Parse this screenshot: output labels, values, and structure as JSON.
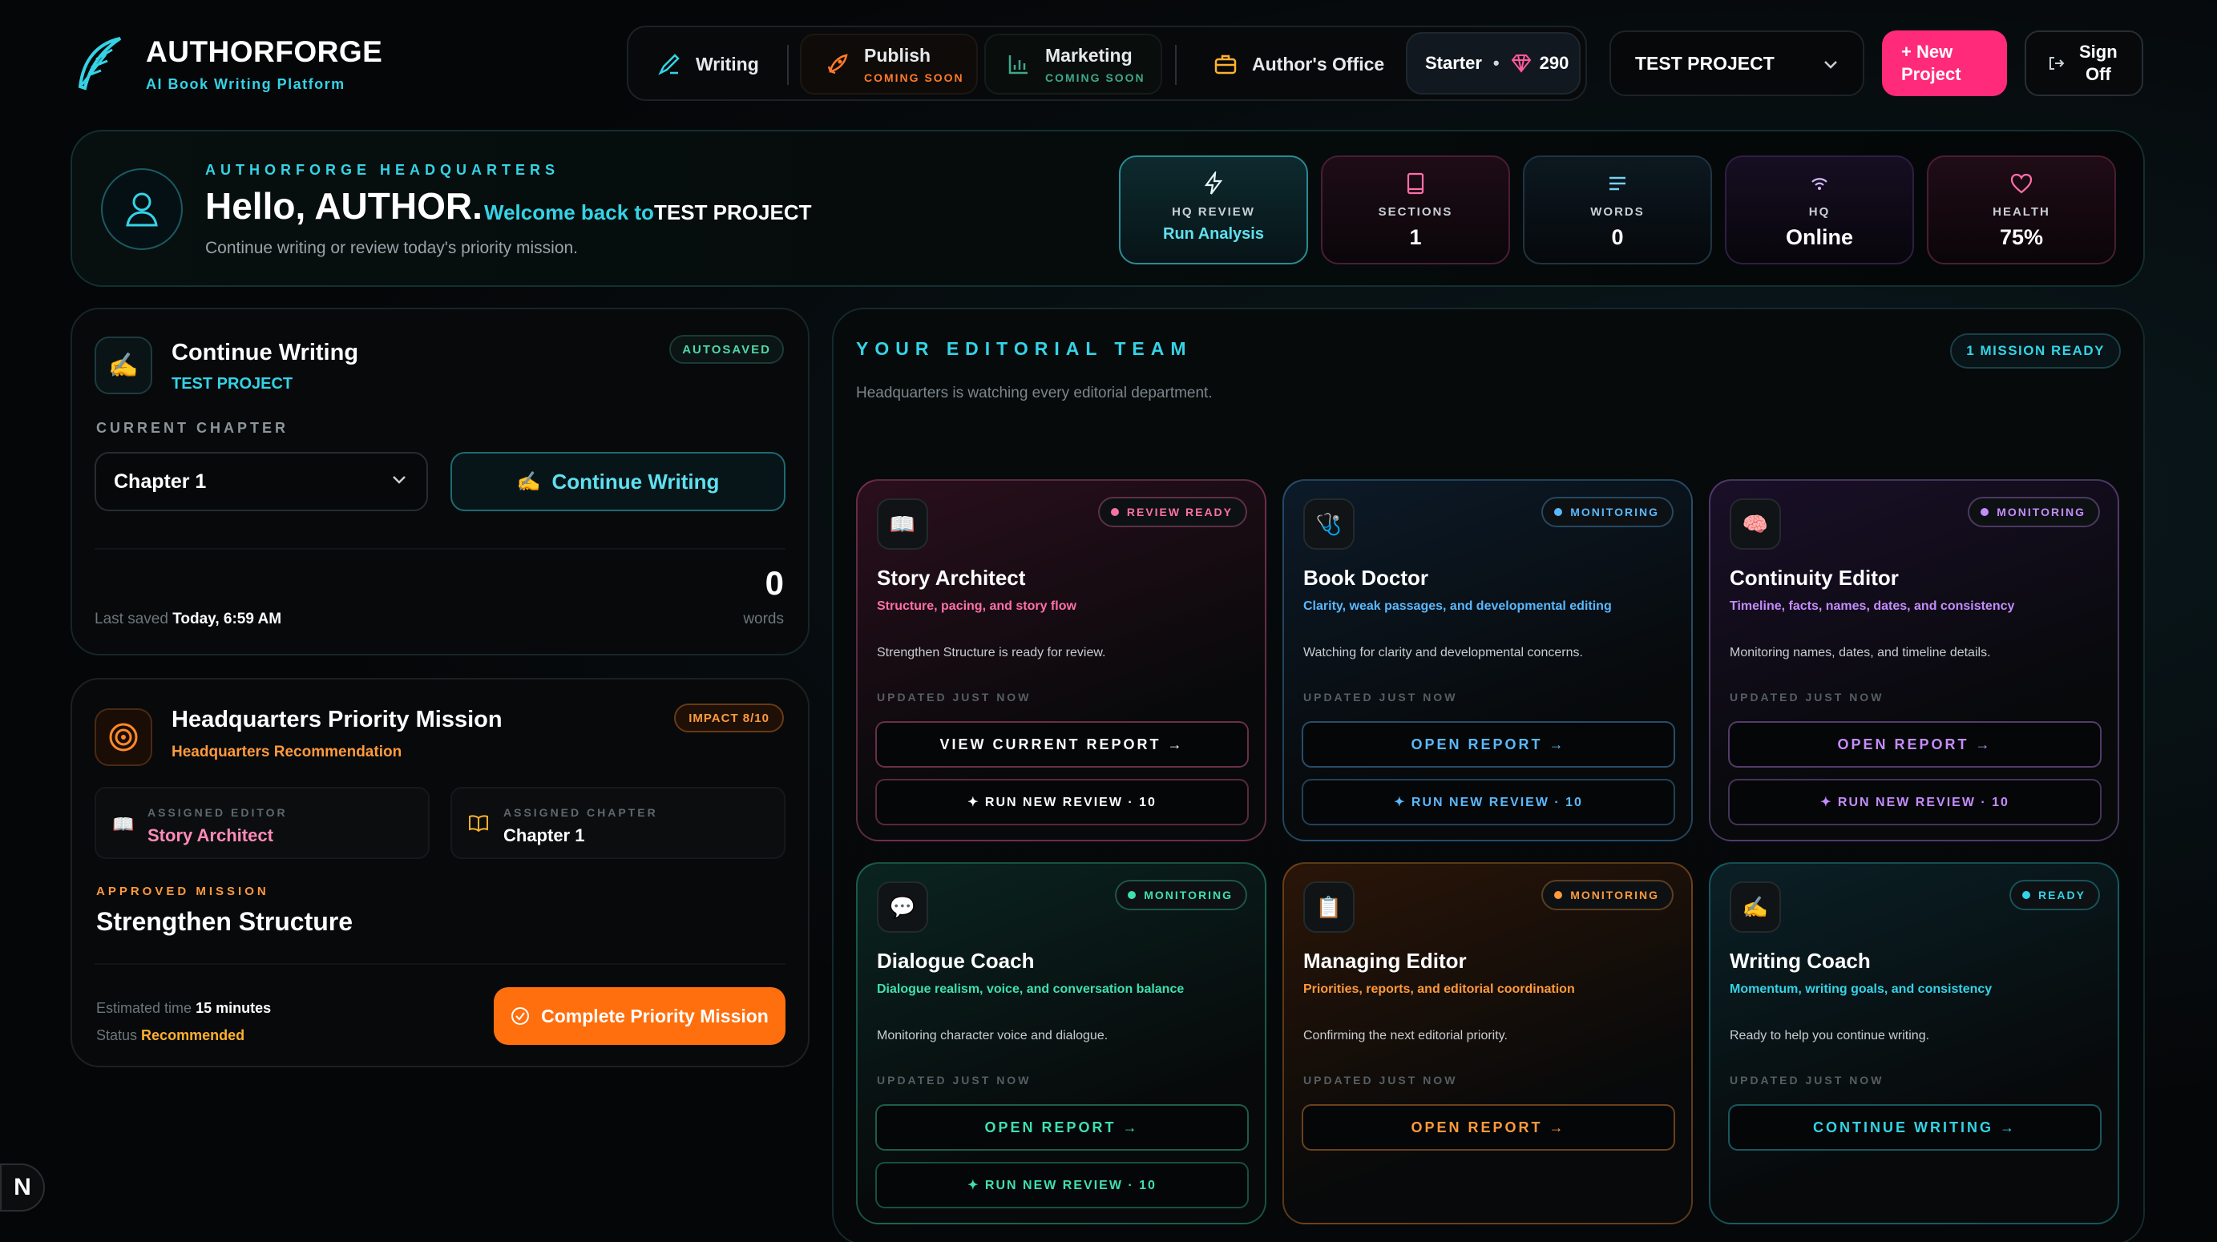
{
  "brand": {
    "name": "AUTHORFORGE",
    "tagline": "AI Book Writing Platform",
    "accent": "#34d3e6"
  },
  "nav": {
    "writing": "Writing",
    "publish": {
      "label": "Publish",
      "tag": "COMING SOON"
    },
    "marketing": {
      "label": "Marketing",
      "tag": "COMING SOON"
    },
    "office": "Author's Office",
    "plan": {
      "name": "Starter",
      "dot": "•",
      "credits": "290"
    },
    "project_select": "TEST PROJECT",
    "new_project": [
      "+ New",
      "Project"
    ],
    "sign_off": [
      "Sign",
      "Off"
    ]
  },
  "hero": {
    "kicker": "AUTHORFORGE HEADQUARTERS",
    "greeting": "Hello, AUTHOR.",
    "welcome": "Welcome back to",
    "project": "TEST PROJECT",
    "subtitle": "Continue writing or review today's priority mission.",
    "stats": [
      {
        "label": "HQ REVIEW",
        "value": "Run Analysis",
        "icon": "lightning-icon",
        "color": "#34d3e6"
      },
      {
        "label": "SECTIONS",
        "value": "1",
        "icon": "book-icon",
        "color": "#ff5a9a"
      },
      {
        "label": "WORDS",
        "value": "0",
        "icon": "text-lines-icon",
        "color": "#7ad0f0"
      },
      {
        "label": "HQ",
        "value": "Online",
        "icon": "wifi-icon",
        "color": "#b26cf0"
      },
      {
        "label": "HEALTH",
        "value": "75%",
        "icon": "heart-icon",
        "color": "#ff5a9a"
      }
    ]
  },
  "continue_writing": {
    "title": "Continue Writing",
    "project": "TEST PROJECT",
    "badge": "AUTOSAVED",
    "chapter_label": "CURRENT CHAPTER",
    "chapter_value": "Chapter 1",
    "button": "Continue Writing",
    "words_value": "0",
    "words_label": "words",
    "last_saved_label": "Last saved",
    "last_saved_value": "Today, 6:59 AM"
  },
  "priority_mission": {
    "title": "Headquarters Priority Mission",
    "subtitle": "Headquarters Recommendation",
    "impact": "IMPACT 8/10",
    "editor_label": "ASSIGNED EDITOR",
    "editor_value": "Story Architect",
    "chapter_label": "ASSIGNED CHAPTER",
    "chapter_value": "Chapter 1",
    "approved_label": "APPROVED MISSION",
    "approved_value": "Strengthen Structure",
    "est_label": "Estimated time",
    "est_value": "15 minutes",
    "status_label": "Status",
    "status_value": "Recommended",
    "button": "Complete Priority Mission"
  },
  "team": {
    "title": "YOUR EDITORIAL TEAM",
    "subtitle": "Headquarters is watching every editorial department.",
    "badge": "1 MISSION READY",
    "editors": [
      {
        "name": "Story Architect",
        "icon": "📖",
        "status": "REVIEW READY",
        "desc": "Structure, pacing, and story flow",
        "msg": "Strengthen Structure is ready for review.",
        "updated": "UPDATED JUST NOW",
        "b1": "VIEW CURRENT REPORT  →",
        "b2": "✦  RUN NEW REVIEW · 10",
        "color": "#ff6fa8"
      },
      {
        "name": "Book Doctor",
        "icon": "🩺",
        "status": "MONITORING",
        "desc": "Clarity, weak passages, and developmental editing",
        "msg": "Watching for clarity and developmental concerns.",
        "updated": "UPDATED JUST NOW",
        "b1": "OPEN REPORT  →",
        "b2": "✦  RUN NEW REVIEW · 10",
        "color": "#5ab8ff"
      },
      {
        "name": "Continuity Editor",
        "icon": "🧠",
        "status": "MONITORING",
        "desc": "Timeline, facts, names, dates, and consistency",
        "msg": "Monitoring names, dates, and timeline details.",
        "updated": "UPDATED JUST NOW",
        "b1": "OPEN REPORT  →",
        "b2": "✦  RUN NEW REVIEW · 10",
        "color": "#c58cff"
      },
      {
        "name": "Dialogue Coach",
        "icon": "💬",
        "status": "MONITORING",
        "desc": "Dialogue realism, voice, and conversation balance",
        "msg": "Monitoring character voice and dialogue.",
        "updated": "UPDATED JUST NOW",
        "b1": "OPEN REPORT  →",
        "b2": "✦  RUN NEW REVIEW · 10",
        "color": "#3ee0b0"
      },
      {
        "name": "Managing Editor",
        "icon": "📋",
        "status": "MONITORING",
        "desc": "Priorities, reports, and editorial coordination",
        "msg": "Confirming the next editorial priority.",
        "updated": "UPDATED JUST NOW",
        "b1": "OPEN REPORT  →",
        "b2": "",
        "color": "#ff9a3d"
      },
      {
        "name": "Writing Coach",
        "icon": "✍️",
        "status": "READY",
        "desc": "Momentum, writing goals, and consistency",
        "msg": "Ready to help you continue writing.",
        "updated": "UPDATED JUST NOW",
        "b1": "CONTINUE WRITING  →",
        "b2": "",
        "color": "#34d3e6"
      }
    ]
  },
  "dev_badge": "N"
}
